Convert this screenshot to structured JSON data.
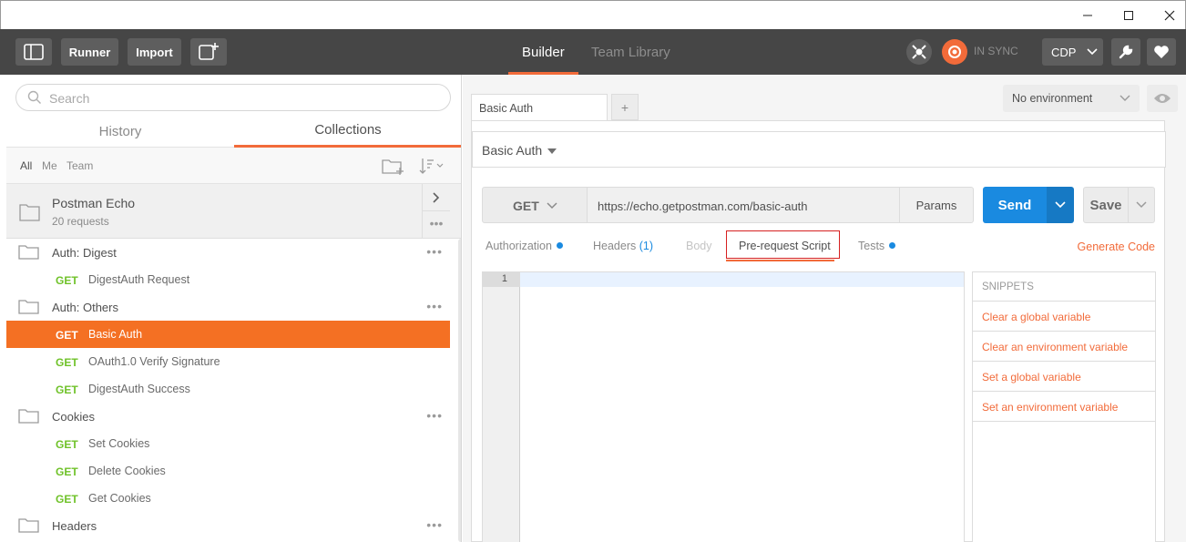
{
  "window": {
    "controls": [
      "minimize",
      "maximize",
      "close"
    ]
  },
  "header": {
    "runner_label": "Runner",
    "import_label": "Import",
    "nav": [
      {
        "label": "Builder",
        "active": true
      },
      {
        "label": "Team Library",
        "active": false
      }
    ],
    "sync_label": "IN SYNC",
    "user_label": "CDP",
    "accent": "#f26b3a"
  },
  "sidebar": {
    "search_placeholder": "Search",
    "tabs": [
      {
        "label": "History",
        "active": false
      },
      {
        "label": "Collections",
        "active": true
      }
    ],
    "filters": [
      "All",
      "Me",
      "Team"
    ],
    "collection": {
      "name": "Postman Echo",
      "count": "20 requests"
    },
    "items": [
      {
        "type": "folder",
        "label": "Auth: Digest"
      },
      {
        "type": "request",
        "method": "GET",
        "label": "DigestAuth Request"
      },
      {
        "type": "folder",
        "label": "Auth: Others"
      },
      {
        "type": "request",
        "method": "GET",
        "label": "Basic Auth",
        "active": true
      },
      {
        "type": "request",
        "method": "GET",
        "label": "OAuth1.0 Verify Signature"
      },
      {
        "type": "request",
        "method": "GET",
        "label": "DigestAuth Success"
      },
      {
        "type": "folder",
        "label": "Cookies"
      },
      {
        "type": "request",
        "method": "GET",
        "label": "Set Cookies"
      },
      {
        "type": "request",
        "method": "GET",
        "label": "Delete Cookies"
      },
      {
        "type": "request",
        "method": "GET",
        "label": "Get Cookies"
      },
      {
        "type": "folder",
        "label": "Headers"
      }
    ]
  },
  "main": {
    "tab_label": "Basic Auth",
    "add_tab": "+",
    "environment": "No environment",
    "request_title": "Basic Auth",
    "method": "GET",
    "url": "https://echo.getpostman.com/basic-auth",
    "params_label": "Params",
    "send_label": "Send",
    "save_label": "Save",
    "subtabs": {
      "authorization": "Authorization",
      "headers": "Headers",
      "headers_count": "(1)",
      "body": "Body",
      "prerequest": "Pre-request Script",
      "tests": "Tests"
    },
    "generate_code": "Generate Code",
    "editor_line": "1",
    "snippets": {
      "title": "SNIPPETS",
      "items": [
        "Clear a global variable",
        "Clear an environment variable",
        "Set a global variable",
        "Set an environment variable"
      ]
    }
  }
}
